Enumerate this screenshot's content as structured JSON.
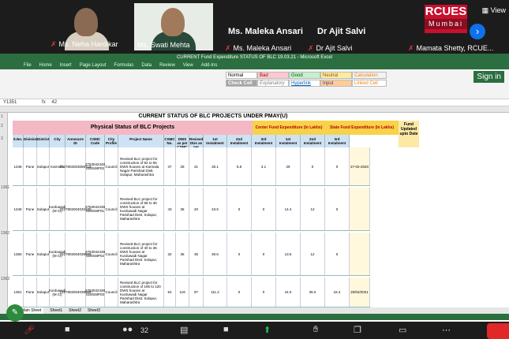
{
  "participants": [
    {
      "name": "Ms. Neha Hardikar",
      "muted": true
    },
    {
      "name": "Ms. Swati Mehta",
      "muted": false
    },
    {
      "name": "Ms. Maleka Ansari",
      "muted": true
    },
    {
      "name": "Dr Ajit Salvi",
      "muted": true
    },
    {
      "name": "Mamata Shetty, RCUE...",
      "muted": true
    }
  ],
  "big_names": [
    "Ms. Maleka Ansari",
    "Dr Ajit Salvi"
  ],
  "logo": {
    "line1": "RCUES",
    "line2": "Mumbai"
  },
  "view_label": "View",
  "excel": {
    "window_title": "CURRENT Fund Expenditure STATUS OF BLC 19.03.21 - Microsoft Excel",
    "tabs": [
      "File",
      "Home",
      "Insert",
      "Page Layout",
      "Formulas",
      "Data",
      "Review",
      "View",
      "Add-Ins"
    ],
    "sign_in": "Sign in",
    "name_box": "Y1351",
    "formula": "42",
    "styles": [
      "Normal",
      "Bad",
      "Good",
      "Neutral",
      "Calculation",
      "Check Cell",
      "Explanatory",
      "Hyperlink",
      "Input",
      "Linked Cell"
    ],
    "sheet_title": "CURRENT STATUS OF BLC PROJECTS UNDER PMAY(U)",
    "band_physical": "Physical Status of BLC Projects",
    "band_center": "Center Fund Expenditure (In Lakhs)",
    "band_state": "State Fund Expenditure (In Lakhs)",
    "band_fund": "Fund Updated upto Date",
    "headers": [
      "S.No.",
      "Division",
      "District",
      "City",
      "Annexure ID",
      "CSMC Code",
      "City Profile",
      "Project Name",
      "CSMC No.",
      "DWS as per CSMC",
      "Revised DUs as per SMM",
      "1st Instalment",
      "2nd Instalment",
      "3rd Instalment",
      "1st Instalment",
      "2nd Instalment",
      "3rd Instalment"
    ],
    "rows": [
      {
        "sno": "1348",
        "division": "Pune",
        "district": "Solapur",
        "city": "Karmala",
        "annex": "7227802003059719",
        "csmc": "2753042448 020048P02",
        "profile": "Council",
        "project": "Revised BLC project for construction of 82 to 55 DWS houses at Karmala Nagar Parishad Distt. Solapur, Maharashtra",
        "csmcno": "37",
        "dws": "29",
        "rev": "31",
        "c1": "30.1",
        "c2": "5.8",
        "c3": "3.1",
        "s1": "29",
        "s2": "0",
        "s3": "0",
        "date": "27-02-2020"
      },
      {
        "sno": "1349",
        "division": "Pune",
        "district": "Solapur",
        "city": "Kurduwadi (M Cl)",
        "annex": "7227802004033180",
        "csmc": "2753042438 020048P01",
        "profile": "Council",
        "project": "Revised BLC project for construction of 58 to 36 DWS houses at Kurduwadi Nagar Parishad Distt. Solapur, Maharashtra",
        "csmcno": "43",
        "dws": "36",
        "rev": "20",
        "c1": "43.5",
        "c2": "0",
        "c3": "0",
        "s1": "14.4",
        "s2": "12",
        "s3": "0",
        "date": ""
      },
      {
        "sno": "1350",
        "division": "Pune",
        "district": "Solapur",
        "city": "Kurduwadi (M Cl)",
        "annex": "7227802004039989",
        "csmc": "2753042438 020048P02",
        "profile": "Council",
        "project": "Revised BLC project for construction of 40 to 36 DWS houses at Kurduwadi Nagar Parishad Distt. Solapur, Maharashtra",
        "csmcno": "32",
        "dws": "36",
        "rev": "35",
        "c1": "30.6",
        "c2": "0",
        "c3": "0",
        "s1": "13.6",
        "s2": "12",
        "s3": "0",
        "date": ""
      },
      {
        "sno": "1351",
        "division": "Pune",
        "district": "Solapur",
        "city": "Kurduwadi (M Cl)",
        "annex": "7227802004039989",
        "csmc": "2753042438 020048P03",
        "profile": "Council",
        "project": "Revised BLC project for construction of 195 to 120 DWS houses at Kurduwadi Nagar Parishad Distt. Solapur, Maharashtra",
        "csmcno": "52",
        "dws": "119",
        "rev": "97",
        "c1": "111.2",
        "c2": "0",
        "c3": "0",
        "s1": "44.0",
        "s2": "36.0",
        "s3": "18.4",
        "date": "20/02/2021"
      }
    ],
    "row_numbers": [
      "1",
      "2",
      "3",
      "1361",
      "1362",
      "1363",
      "1364"
    ],
    "sheet_tabs": [
      "Main Sheet",
      "Sheet1",
      "Sheet2",
      "Sheet3"
    ]
  },
  "taskbar": {
    "participants_count": "32"
  }
}
